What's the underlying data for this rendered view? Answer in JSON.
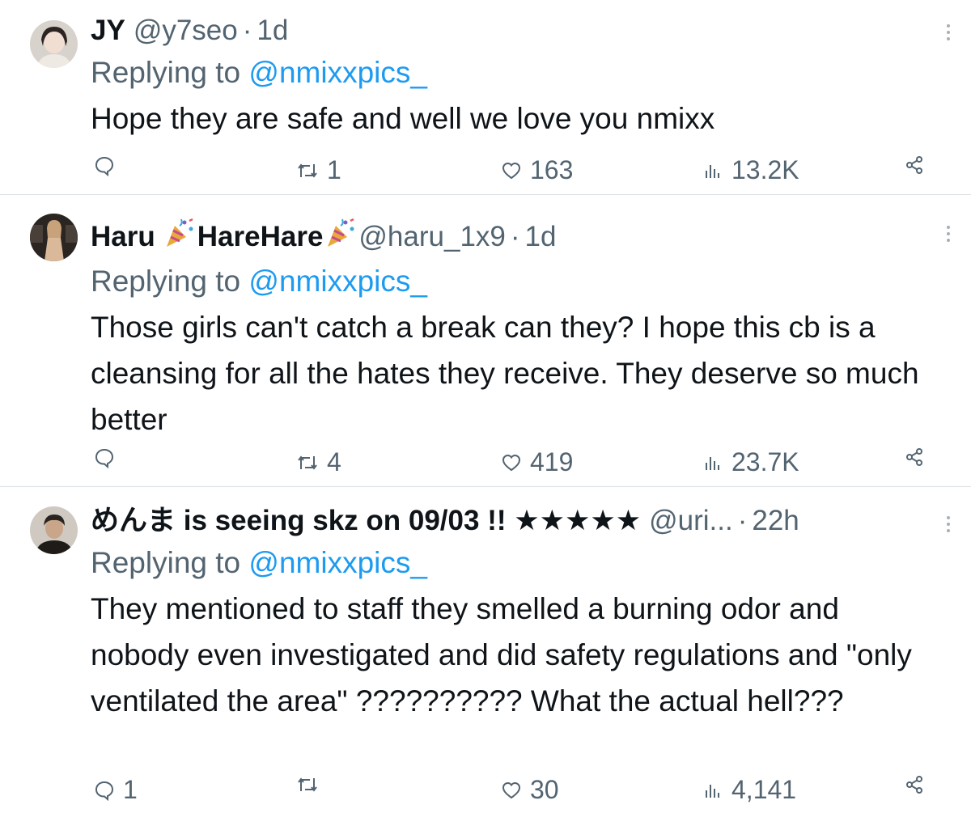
{
  "replying_label": "Replying to",
  "tweets": [
    {
      "name": "JY",
      "handle": "@y7seo",
      "separator": "·",
      "time": "1d",
      "mention": "@nmixxpics_",
      "text": "Hope they are safe and well we love you nmixx",
      "replies": "",
      "retweets": "1",
      "likes": "163",
      "views": "13.2K"
    },
    {
      "name": "Haru",
      "name_mid": "HareHare",
      "handle": "@haru_1x9",
      "separator": "·",
      "time": "1d",
      "mention": "@nmixxpics_",
      "text": "Those girls can't catch a break can they? I hope this cb is a cleansing for all the hates they receive. They deserve so much better",
      "replies": "",
      "retweets": "4",
      "likes": "419",
      "views": "23.7K"
    },
    {
      "name": "めんま is seeing skz on 09/03 !! ★★★★★",
      "handle": "@uri...",
      "separator": "·",
      "time": "22h",
      "mention": "@nmixxpics_",
      "text": "They mentioned to staff they smelled a burning odor and nobody even investigated and did safety regulations and \"only ventilated the area\" ?????????? What the actual hell???",
      "replies": "1",
      "retweets": "",
      "likes": "30",
      "views": "4,141"
    }
  ],
  "icons": {
    "reply": "reply-icon",
    "retweet": "retweet-icon",
    "like": "heart-icon",
    "views": "views-icon",
    "share": "share-icon",
    "more": "more-icon",
    "emoji": "party-popper-icon"
  },
  "colors": {
    "mention": "#1d9bf0",
    "secondary": "#536471",
    "text": "#0f1419",
    "divider": "#dfe3e6"
  }
}
